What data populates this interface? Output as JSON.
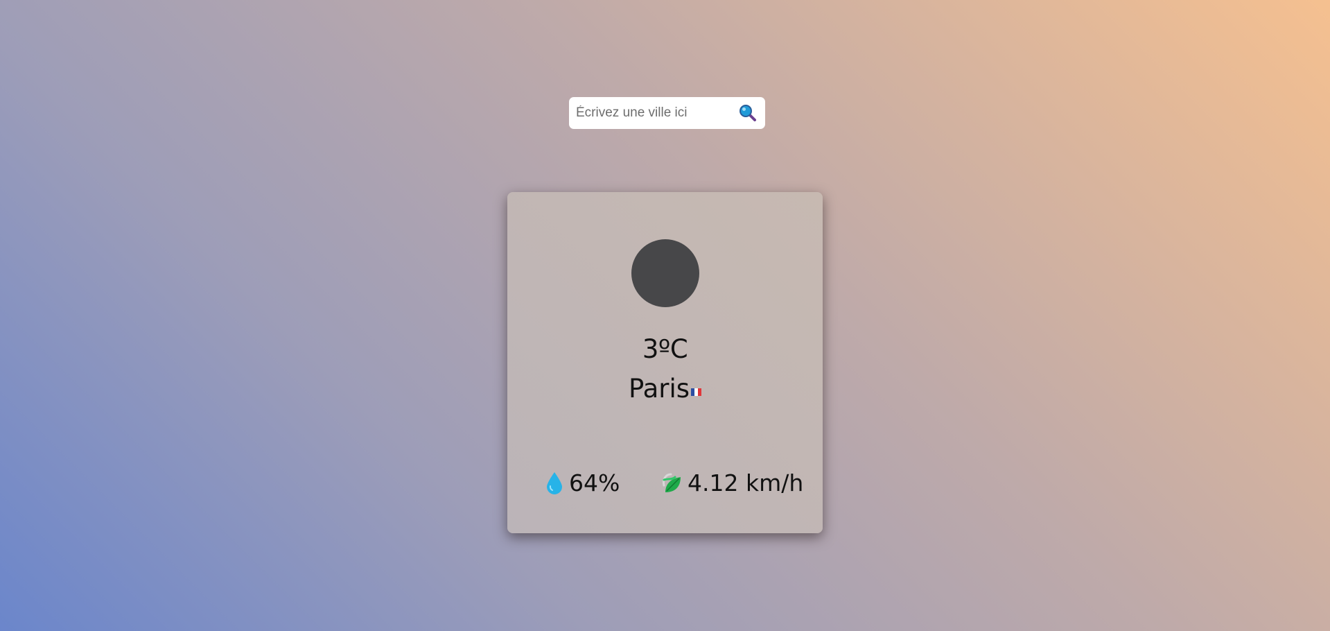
{
  "search": {
    "placeholder": "Écrivez une ville ici",
    "value": "",
    "icon": "magnifier-icon"
  },
  "weather": {
    "icon": "weather-icon-placeholder",
    "temperature": "3ºC",
    "city": "Paris",
    "country_flag": "france-flag-icon",
    "humidity": "64%",
    "humidity_icon": "droplet-icon",
    "wind": "4.12 km/h",
    "wind_icon": "leaf-wind-icon"
  },
  "colors": {
    "gradient_start": "#6b86cb",
    "gradient_end": "#f5c090",
    "card_background": "#c2b7b5",
    "icon_circle": "#474749"
  }
}
